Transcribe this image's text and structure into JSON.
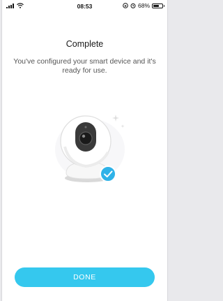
{
  "status_bar": {
    "time": "08:53",
    "battery_percent": "68%",
    "battery_level": 0.68
  },
  "header": {
    "title": "Complete"
  },
  "message": {
    "text": "You've configured your smart device and it's ready for use."
  },
  "actions": {
    "done_label": "DONE"
  },
  "colors": {
    "accent": "#35c8ee",
    "check_badge": "#2fb2e8"
  }
}
